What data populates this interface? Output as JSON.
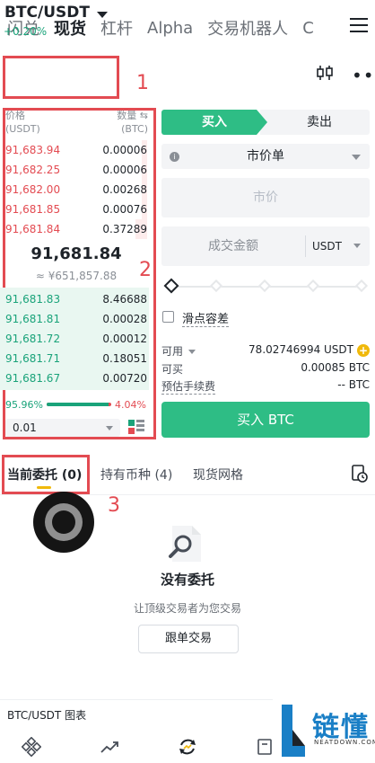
{
  "top_tabs": [
    {
      "label": "闪兑"
    },
    {
      "label": "现货"
    },
    {
      "label": "杠杆"
    },
    {
      "label": "Alpha"
    },
    {
      "label": "交易机器人"
    },
    {
      "label": "C"
    }
  ],
  "active_top_tab": "现货",
  "pair": {
    "name": "BTC/USDT",
    "change": "+0.20%"
  },
  "annotations": [
    "1",
    "2",
    "3"
  ],
  "orderbook": {
    "price_header": "价格",
    "price_unit": "(USDT)",
    "qty_header": "数量 ⇆",
    "qty_unit": "(BTC)",
    "asks": [
      {
        "price": "91,683.94",
        "qty": "0.00006",
        "depth": 0.04
      },
      {
        "price": "91,682.25",
        "qty": "0.00006",
        "depth": 0.04
      },
      {
        "price": "91,682.00",
        "qty": "0.00268",
        "depth": 0.04
      },
      {
        "price": "91,681.85",
        "qty": "0.00076",
        "depth": 0.04
      },
      {
        "price": "91,681.84",
        "qty": "0.37289",
        "depth": 0.08
      }
    ],
    "last_price": "91,681.84",
    "last_price_fiat": "≈ ¥651,857.88",
    "bids": [
      {
        "price": "91,681.83",
        "qty": "8.46688"
      },
      {
        "price": "91,681.81",
        "qty": "0.00028"
      },
      {
        "price": "91,681.72",
        "qty": "0.00012"
      },
      {
        "price": "91,681.71",
        "qty": "0.18051"
      },
      {
        "price": "91,681.67",
        "qty": "0.00720"
      }
    ],
    "bid_ratio": "95.96%",
    "ask_ratio": "4.04%",
    "bid_ratio_value": 0.9596,
    "step": "0.01"
  },
  "trade": {
    "buy_tab": "买入",
    "sell_tab": "卖出",
    "order_type": "市价单",
    "info_glyph": "i",
    "price_placeholder": "市价",
    "amount_placeholder": "成交金额",
    "amount_unit": "USDT",
    "slippage_label": "滑点容差",
    "available_label": "可用",
    "available_value": "78.02746994 USDT",
    "plus_glyph": "+",
    "can_buy_label": "可买",
    "can_buy_value": "0.00085 BTC",
    "fee_label": "预估手续费",
    "fee_value": "-- BTC",
    "buy_button": "买入 BTC"
  },
  "bottom_tabs": {
    "open_orders": "当前委托 (0)",
    "holdings": "持有币种 (4)",
    "grid": "现货网格"
  },
  "empty_state": {
    "title": "没有委托",
    "subtitle": "让顶级交易者为您交易",
    "button": "跟单交易"
  },
  "chart_label": "BTC/USDT 图表",
  "watermark": {
    "text": "链懂",
    "sub": "NEATDOWN.COM"
  },
  "colors": {
    "buy": "#2ebd85",
    "sell": "#e34b52",
    "annotation": "#e34b52",
    "accent": "#f0b90b"
  }
}
